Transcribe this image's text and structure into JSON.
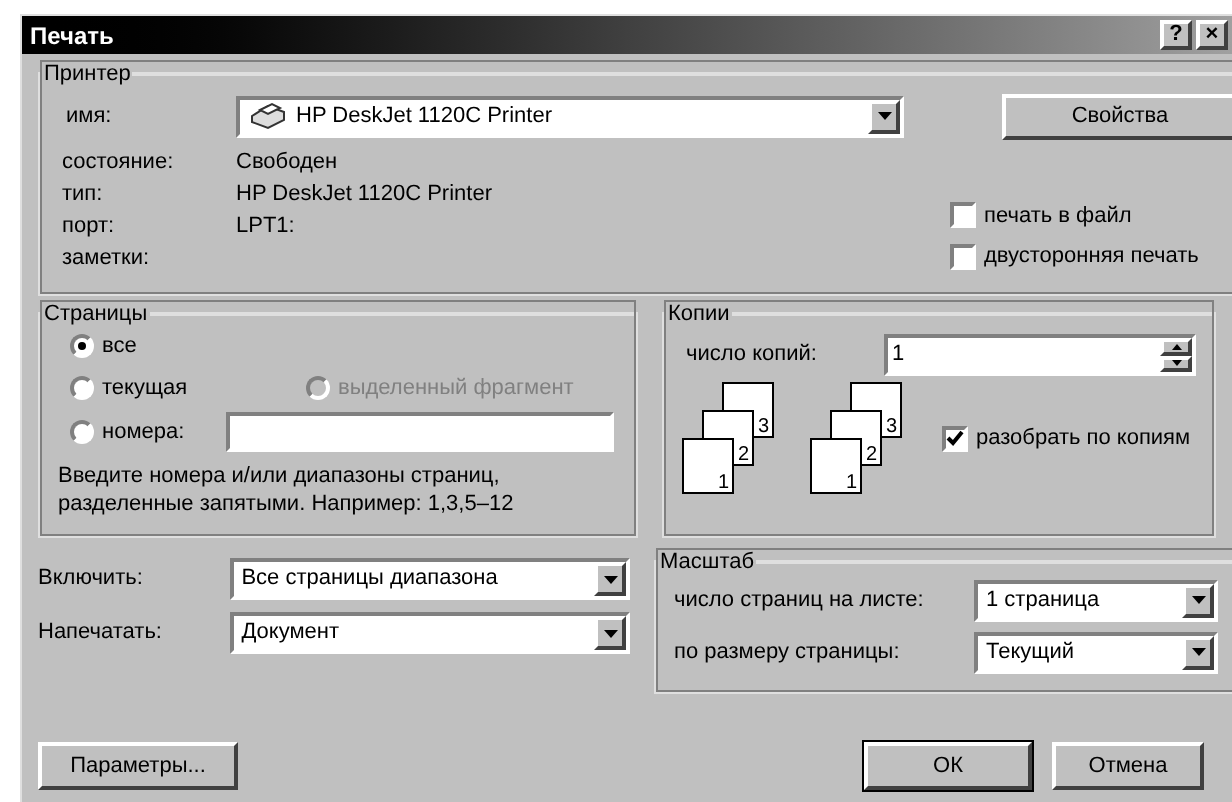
{
  "window": {
    "title": "Печать",
    "help_button": "?",
    "close_button": "×"
  },
  "printer": {
    "legend": "Принтер",
    "name_label": "имя:",
    "name_value": "HP DeskJet 1120C Printer",
    "properties_button": "Свойства",
    "info": [
      {
        "label": "состояние:",
        "value": "Свободен"
      },
      {
        "label": "тип:",
        "value": "HP DeskJet 1120C Printer"
      },
      {
        "label": "порт:",
        "value": "LPT1:"
      },
      {
        "label": "заметки:"
      }
    ],
    "options": [
      {
        "label": "печать в файл",
        "checked": false
      },
      {
        "label": "двусторонняя печать",
        "checked": false
      }
    ]
  },
  "pages": {
    "legend": "Страницы",
    "options": [
      {
        "label": "все",
        "selected": true,
        "disabled": false
      },
      {
        "label": "текущая",
        "selected": false,
        "disabled": false
      },
      {
        "label": "выделенный фрагмент",
        "selected": false,
        "disabled": true
      },
      {
        "label": "номера:",
        "selected": false,
        "disabled": false
      }
    ],
    "hint": "Введите номера и/или диапазоны страниц, разделенные запятыми. Например: 1,3,5–12"
  },
  "copies": {
    "legend": "Копии",
    "count_label": "число копий:",
    "count_value": "1",
    "stacks": [
      [
        "1",
        "2",
        "3"
      ],
      [
        "1",
        "2",
        "3"
      ]
    ],
    "collate": {
      "label": "разобрать по копиям",
      "checked": true
    }
  },
  "include": [
    {
      "label": "Включить:",
      "value": "Все страницы диапазона"
    },
    {
      "label": "Напечатать:",
      "value": "Документ"
    }
  ],
  "scale": {
    "legend": "Масштаб",
    "fields": [
      {
        "label": "число страниц на листе:",
        "value": "1 страница"
      },
      {
        "label": "по размеру страницы:",
        "value": "Текущий"
      }
    ]
  },
  "buttons": {
    "options": "Параметры...",
    "ok": "ОК",
    "cancel": "Отмена"
  }
}
